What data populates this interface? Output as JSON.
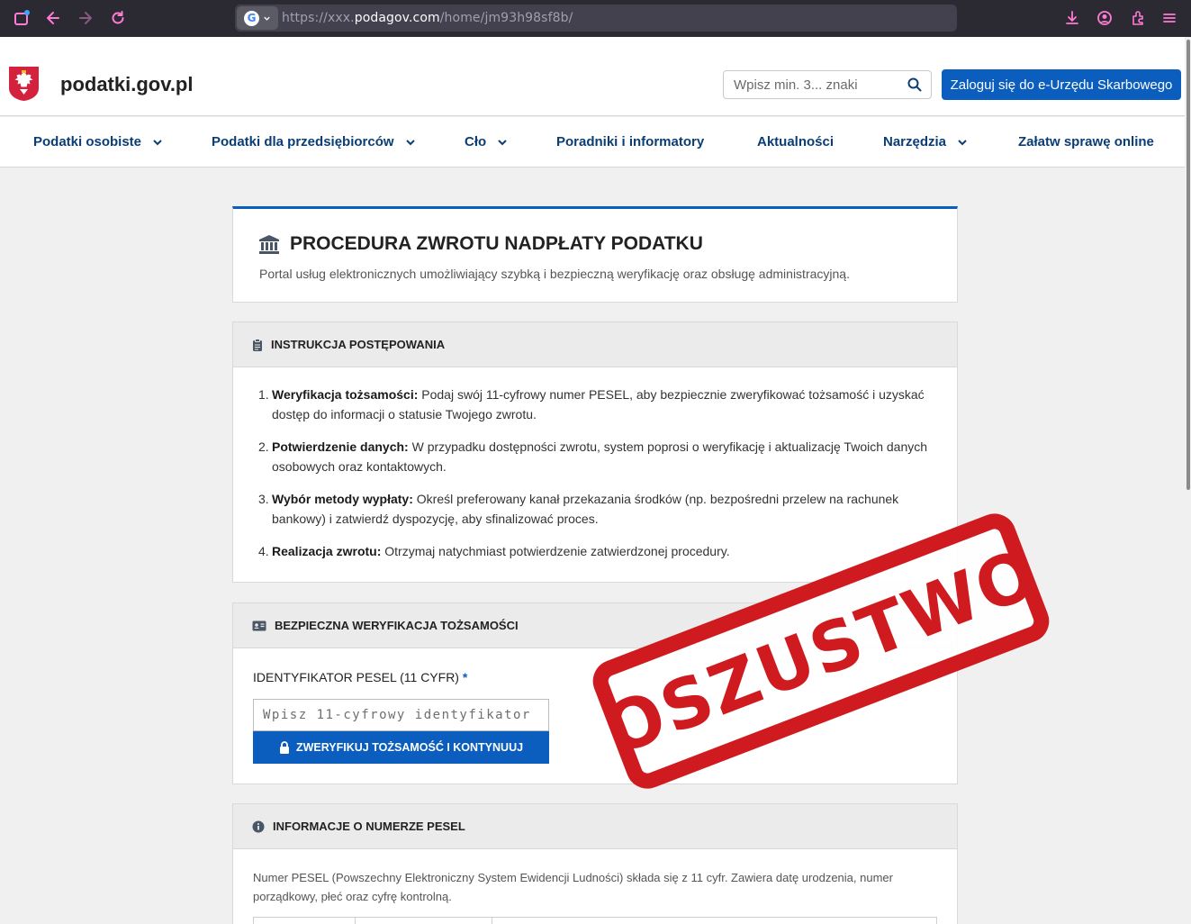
{
  "browser": {
    "url_prefix": "https://xxx.",
    "url_domain": "podagov.com",
    "url_path": "/home/jm93h98sf8b/"
  },
  "header": {
    "site_title": "podatki.gov.pl",
    "search_placeholder": "Wpisz min. 3... znaki",
    "login_label": "Zaloguj się do e-Urzędu Skarbowego"
  },
  "nav": [
    {
      "label": "Podatki osobiste"
    },
    {
      "label": "Podatki dla przedsiębiorców"
    },
    {
      "label": "Cło"
    },
    {
      "label": "Poradniki i informatory"
    },
    {
      "label": "Aktualności"
    },
    {
      "label": "Narzędzia"
    },
    {
      "label": "Załatw sprawę online"
    }
  ],
  "hero": {
    "title": "PROCEDURA ZWROTU NADPŁATY PODATKU",
    "subtitle": "Portal usług elektronicznych umożliwiający szybką i bezpieczną weryfikację oraz obsługę administracyjną."
  },
  "instructions": {
    "heading": "INSTRUKCJA POSTĘPOWANIA",
    "steps": [
      {
        "num": "1.",
        "title": "Weryfikacja tożsamości:",
        "text": " Podaj swój 11-cyfrowy numer PESEL, aby bezpiecznie zweryfikować tożsamość i uzyskać dostęp do informacji o statusie Twojego zwrotu."
      },
      {
        "num": "2.",
        "title": "Potwierdzenie danych:",
        "text": " W przypadku dostępności zwrotu, system poprosi o weryfikację i aktualizację Twoich danych osobowych oraz kontaktowych."
      },
      {
        "num": "3.",
        "title": "Wybór metody wypłaty:",
        "text": " Określ preferowany kanał przekazania środków (np. bezpośredni przelew na rachunek bankowy) i zatwierdź dyspozycję, aby sfinalizować proces."
      },
      {
        "num": "4.",
        "title": "Realizacja zwrotu:",
        "text": " Otrzymaj natychmiast potwierdzenie zatwierdzonej procedury."
      }
    ]
  },
  "verify": {
    "heading": "BEZPIECZNA WERYFIKACJA TOŻSAMOŚCI",
    "field_label": "IDENTYFIKATOR PESEL (11 CYFR)",
    "required_mark": "*",
    "input_placeholder": "Wpisz 11-cyfrowy identyfikator",
    "button_label": "ZWERYFIKUJ TOŻSAMOŚĆ I KONTYNUUJ"
  },
  "info": {
    "heading": "INFORMACJE O NUMERZE PESEL",
    "text": "Numer PESEL (Powszechny Elektroniczny System Ewidencji Ludności) składa się z 11 cyfr. Zawiera datę urodzenia, numer porządkowy, płeć oraz cyfrę kontrolną."
  },
  "stamp": {
    "text": "OSZUSTWO",
    "color": "#cf1a1f"
  },
  "colors": {
    "brand_blue": "#0b5ebd",
    "nav_text": "#0b3d75"
  }
}
